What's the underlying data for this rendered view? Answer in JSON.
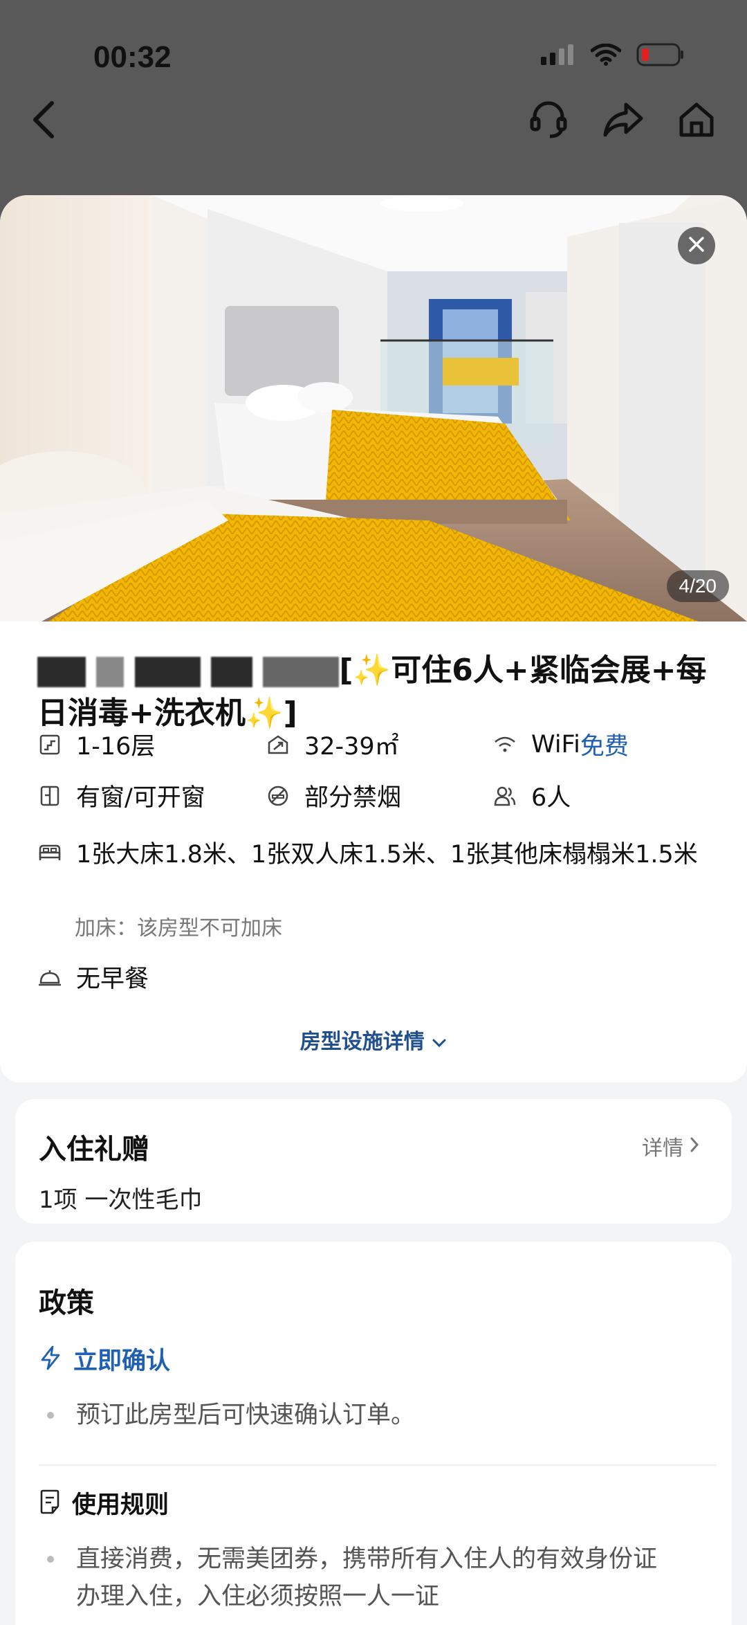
{
  "status_bar": {
    "time": "00:32"
  },
  "icons": {
    "back": "back-arrow-icon",
    "service": "customer-service-icon",
    "share": "share-icon",
    "home": "home-icon",
    "close": "close-icon"
  },
  "photo": {
    "counter": "4/20"
  },
  "room": {
    "title_visible": "[✨可住6人+紧临会展+每日消毒+洗衣机✨]",
    "facilities": {
      "floor": "1-16层",
      "area": "32-39㎡",
      "wifi_prefix": "WiFi",
      "wifi_status": "免费",
      "window": "有窗/可开窗",
      "smoking": "部分禁烟",
      "capacity": "6人",
      "beds": "1张大床1.8米、1张双人床1.5米、1张其他床榻榻米1.5米",
      "extra_bed": "加床：该房型不可加床",
      "breakfast": "无早餐"
    },
    "details_link": "房型设施详情"
  },
  "gift": {
    "title": "入住礼赠",
    "link": "详情",
    "count": "1项",
    "item": "一次性毛巾"
  },
  "policy": {
    "title": "政策",
    "instant_confirm": "立即确认",
    "instant_desc": "预订此房型后可快速确认订单。",
    "rules_title": "使用规则",
    "rules_line1": "直接消费，无需美团券，携带所有入住人的有效身份证",
    "rules_line2": "办理入住，入住必须按照一人一证"
  },
  "colors": {
    "accent_blue": "#1f5fb4",
    "bedspread_yellow": "#f2b705"
  }
}
